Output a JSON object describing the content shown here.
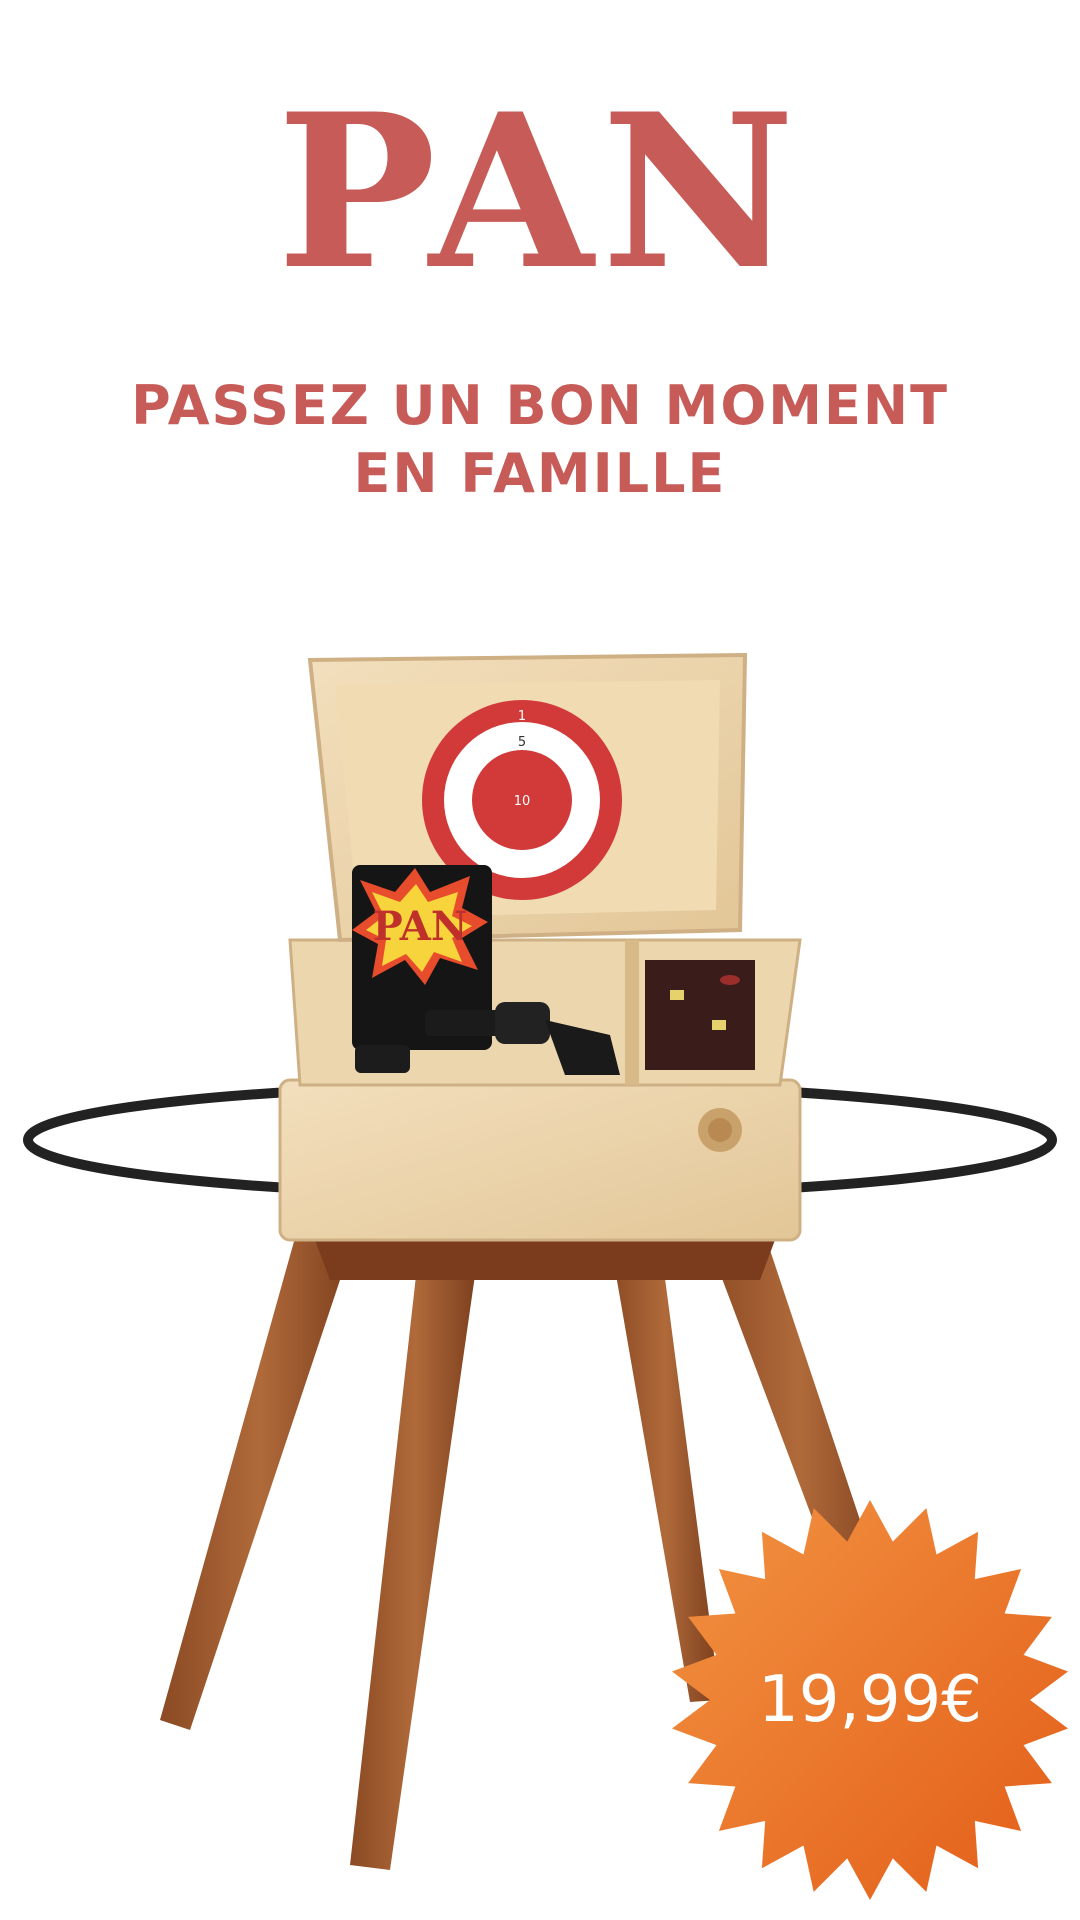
{
  "title": "PAN",
  "subtitle": {
    "line1": "PASSEZ UN BON MOMENT",
    "line2": "EN FAMILLE"
  },
  "target_numbers": [
    "1",
    "5",
    "10"
  ],
  "card_label": "PAN",
  "price": "19,99€",
  "colors": {
    "brand_red": "#c75b57",
    "badge_orange": "#ea6a22",
    "background": "#ffffff"
  }
}
